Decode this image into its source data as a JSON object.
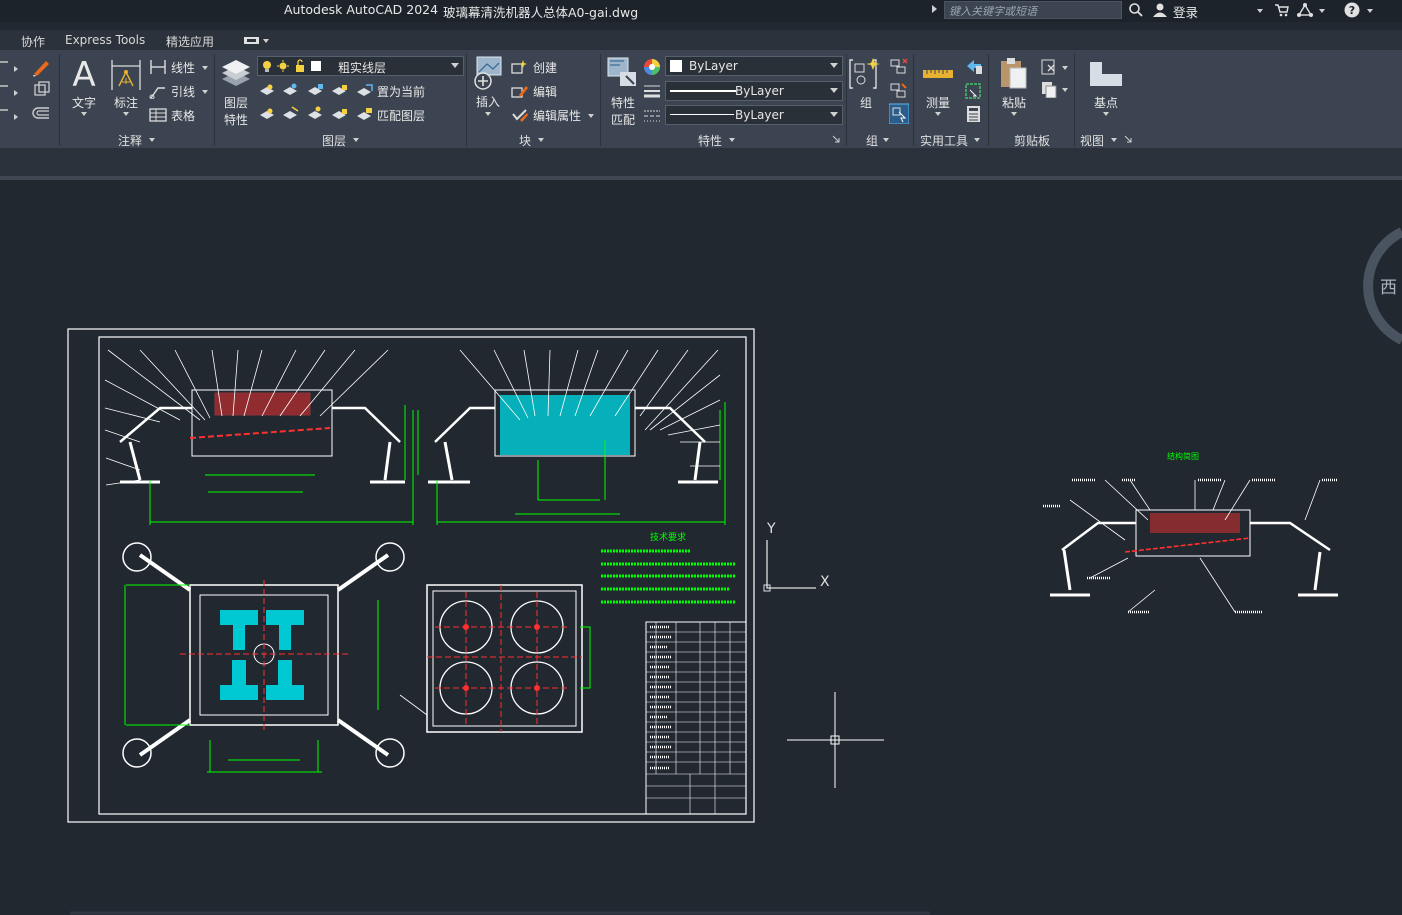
{
  "titlebar": {
    "app": "Autodesk AutoCAD 2024",
    "file": "玻璃幕清洗机器人总体A0-gai.dwg",
    "search_placeholder": "键入关键字或短语",
    "login": "登录"
  },
  "tabs": [
    {
      "label": "协作"
    },
    {
      "label": "Express Tools"
    },
    {
      "label": "精选应用"
    }
  ],
  "ribbon": {
    "annotate": {
      "panel_label": "注释",
      "text_label": "文字",
      "dim_label": "标注",
      "linear_label": "线性",
      "leader_label": "引线",
      "table_label": "表格"
    },
    "layers": {
      "panel_label": "图层",
      "props_label_1": "图层",
      "props_label_2": "特性",
      "current_layer": "粗实线层",
      "set_current": "置为当前",
      "match_layer": "匹配图层"
    },
    "block": {
      "panel_label": "块",
      "insert_label": "插入",
      "create_label": "创建",
      "edit_label": "编辑",
      "edit_attr_label": "编辑属性"
    },
    "properties": {
      "panel_label": "特性",
      "match_label_1": "特性",
      "match_label_2": "匹配",
      "color": "ByLayer",
      "lineweight": "ByLayer",
      "linetype": "ByLayer"
    },
    "groups": {
      "panel_label": "组",
      "group_label": "组"
    },
    "utilities": {
      "panel_label": "实用工具",
      "measure_label": "测量"
    },
    "clipboard": {
      "panel_label": "剪贴板",
      "paste_label": "粘贴"
    },
    "view": {
      "panel_label": "视图",
      "base_label": "基点"
    }
  },
  "viewcube": {
    "west_label": "西"
  },
  "drawing": {
    "tech_title": "技术要求",
    "right_view_title": "结构简图",
    "ucs_y": "Y",
    "ucs_x": "X"
  },
  "colors": {
    "background": "#212830",
    "ribbon": "#3b4450",
    "dimension": "#00ff00",
    "hatch": "#00c8d2",
    "centerline": "#ff2020",
    "line": "#ffffff"
  }
}
